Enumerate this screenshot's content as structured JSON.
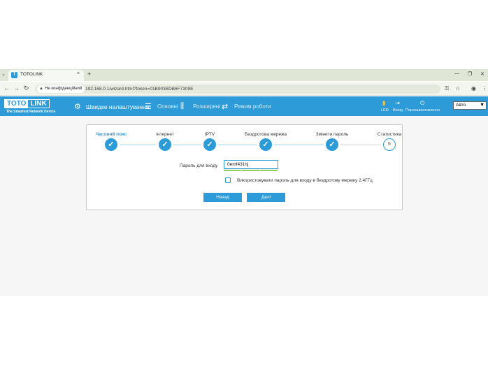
{
  "browser": {
    "tab_title": "TOTOLINK",
    "tab_favicon": "T",
    "new_tab": "+",
    "close_tab": "×",
    "security_chip": "Не конфіденційний",
    "url": "192.168.0.1/wizard.html?token=01B903BDB6F7309E"
  },
  "header": {
    "logo_left": "TOTO",
    "logo_right": "LINK",
    "logo_tagline": "The Smartest Network Device",
    "menu": [
      {
        "label": "Швидке налаштування",
        "icon": "gear-icon"
      },
      {
        "label": "Основні",
        "icon": "sliders-icon"
      },
      {
        "label": "Розширені",
        "icon": "equalizer-icon"
      },
      {
        "label": "Режим роботи",
        "icon": "switch-icon"
      }
    ],
    "right": [
      {
        "label": "LED",
        "icon": "led-icon"
      },
      {
        "label": "Вихід",
        "icon": "logout-icon"
      },
      {
        "label": "Перезавантаження",
        "icon": "power-icon"
      }
    ],
    "language": "Авто"
  },
  "wizard": {
    "steps": [
      {
        "label": "Часовий пояс",
        "state": "done"
      },
      {
        "label": "Інтернет",
        "state": "done"
      },
      {
        "label": "IPTV",
        "state": "done"
      },
      {
        "label": "Бездротова мережа",
        "state": "done"
      },
      {
        "label": "Змінити пароль",
        "state": "done"
      },
      {
        "label": "Статистика",
        "state": "current",
        "number": "6"
      }
    ],
    "password_label": "Пароль для входу",
    "password_value": "0emf431hj",
    "checkbox_label": "Використовувати пароль для входу в бездротову мережу 2,4ГГц",
    "back_button": "Назад",
    "next_button": "Далі"
  },
  "colors": {
    "accent": "#2d9bd8",
    "strength": "#8bcf5a"
  }
}
